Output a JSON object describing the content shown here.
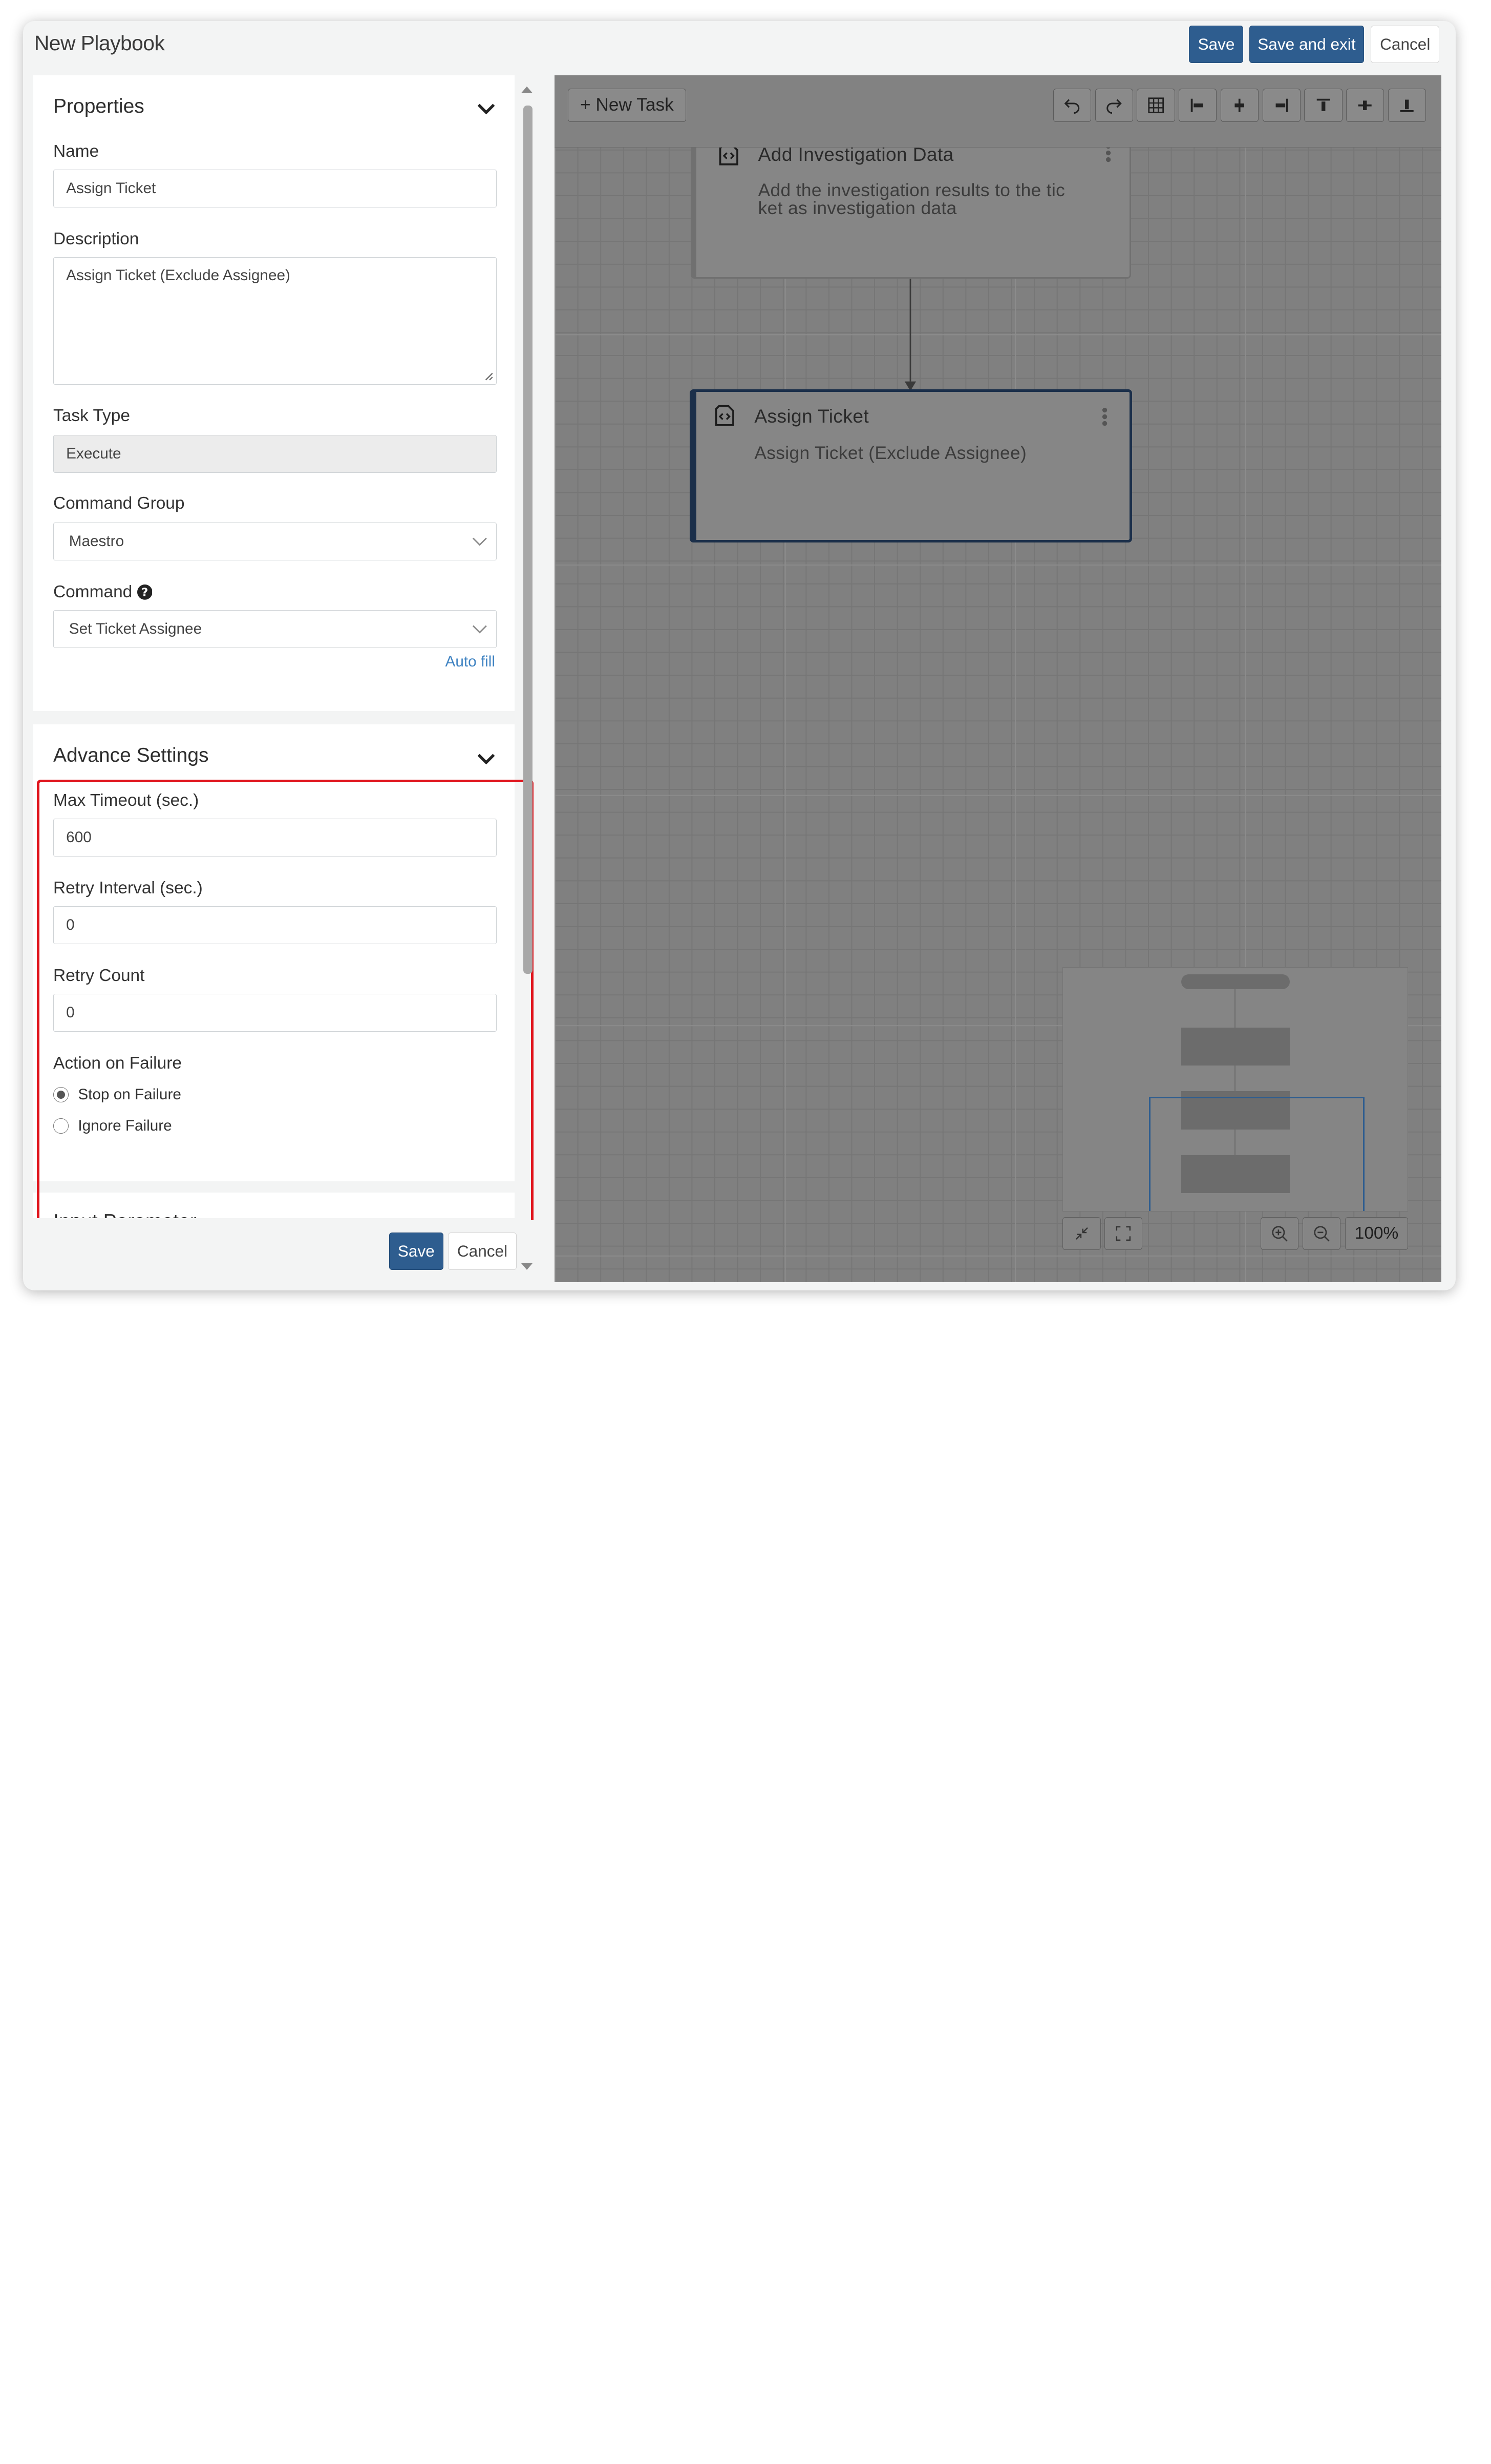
{
  "header": {
    "title": "New Playbook",
    "save_label": "Save",
    "save_exit_label": "Save and exit",
    "cancel_label": "Cancel"
  },
  "properties": {
    "title": "Properties",
    "name_label": "Name",
    "name_value": "Assign Ticket",
    "description_label": "Description",
    "description_value": "Assign Ticket (Exclude Assignee)",
    "task_type_label": "Task Type",
    "task_type_value": "Execute",
    "command_group_label": "Command Group",
    "command_group_value": "Maestro",
    "command_label": "Command",
    "command_value": "Set Ticket Assignee",
    "autofill_label": "Auto fill"
  },
  "advance": {
    "title": "Advance Settings",
    "max_timeout_label": "Max Timeout (sec.)",
    "max_timeout_value": "600",
    "retry_interval_label": "Retry Interval (sec.)",
    "retry_interval_value": "0",
    "retry_count_label": "Retry Count",
    "retry_count_value": "0",
    "action_label": "Action on Failure",
    "options": [
      {
        "label": "Stop on Failure",
        "selected": true
      },
      {
        "label": "Ignore Failure",
        "selected": false
      }
    ]
  },
  "input_parameter": {
    "title": "Input Parameter"
  },
  "footer": {
    "save_label": "Save",
    "cancel_label": "Cancel"
  },
  "canvas": {
    "new_task_label": "+ New Task",
    "nodes": [
      {
        "title": "Add Investigation Data",
        "description_lines": [
          "Add the investigation results to the tic",
          "ket as investigation data"
        ]
      },
      {
        "title": "Assign Ticket",
        "description_lines": [
          "Assign Ticket (Exclude Assignee)"
        ]
      }
    ],
    "zoom": "100%"
  },
  "colors": {
    "primary": "#2e5d8f",
    "highlight": "#e0141c",
    "link": "#3f83c2",
    "selected_node_border": "#1b2f4a"
  }
}
